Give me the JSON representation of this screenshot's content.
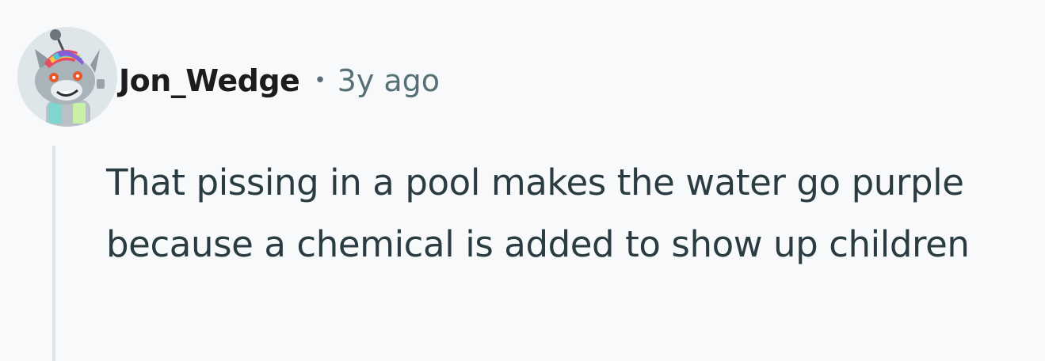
{
  "comment": {
    "author": "Jon_Wedge",
    "separator": "•",
    "time_ago": "3y ago",
    "body": "That pissing in a pool makes the water go purple because a chemical is added to show up children",
    "avatar_icon": "snoo-avatar-icon"
  },
  "colors": {
    "background": "#f7f9fa",
    "author": "#1c1c1c",
    "meta": "#576f76",
    "body_text": "#2a3c42",
    "thread_line": "#dfe4e8"
  }
}
